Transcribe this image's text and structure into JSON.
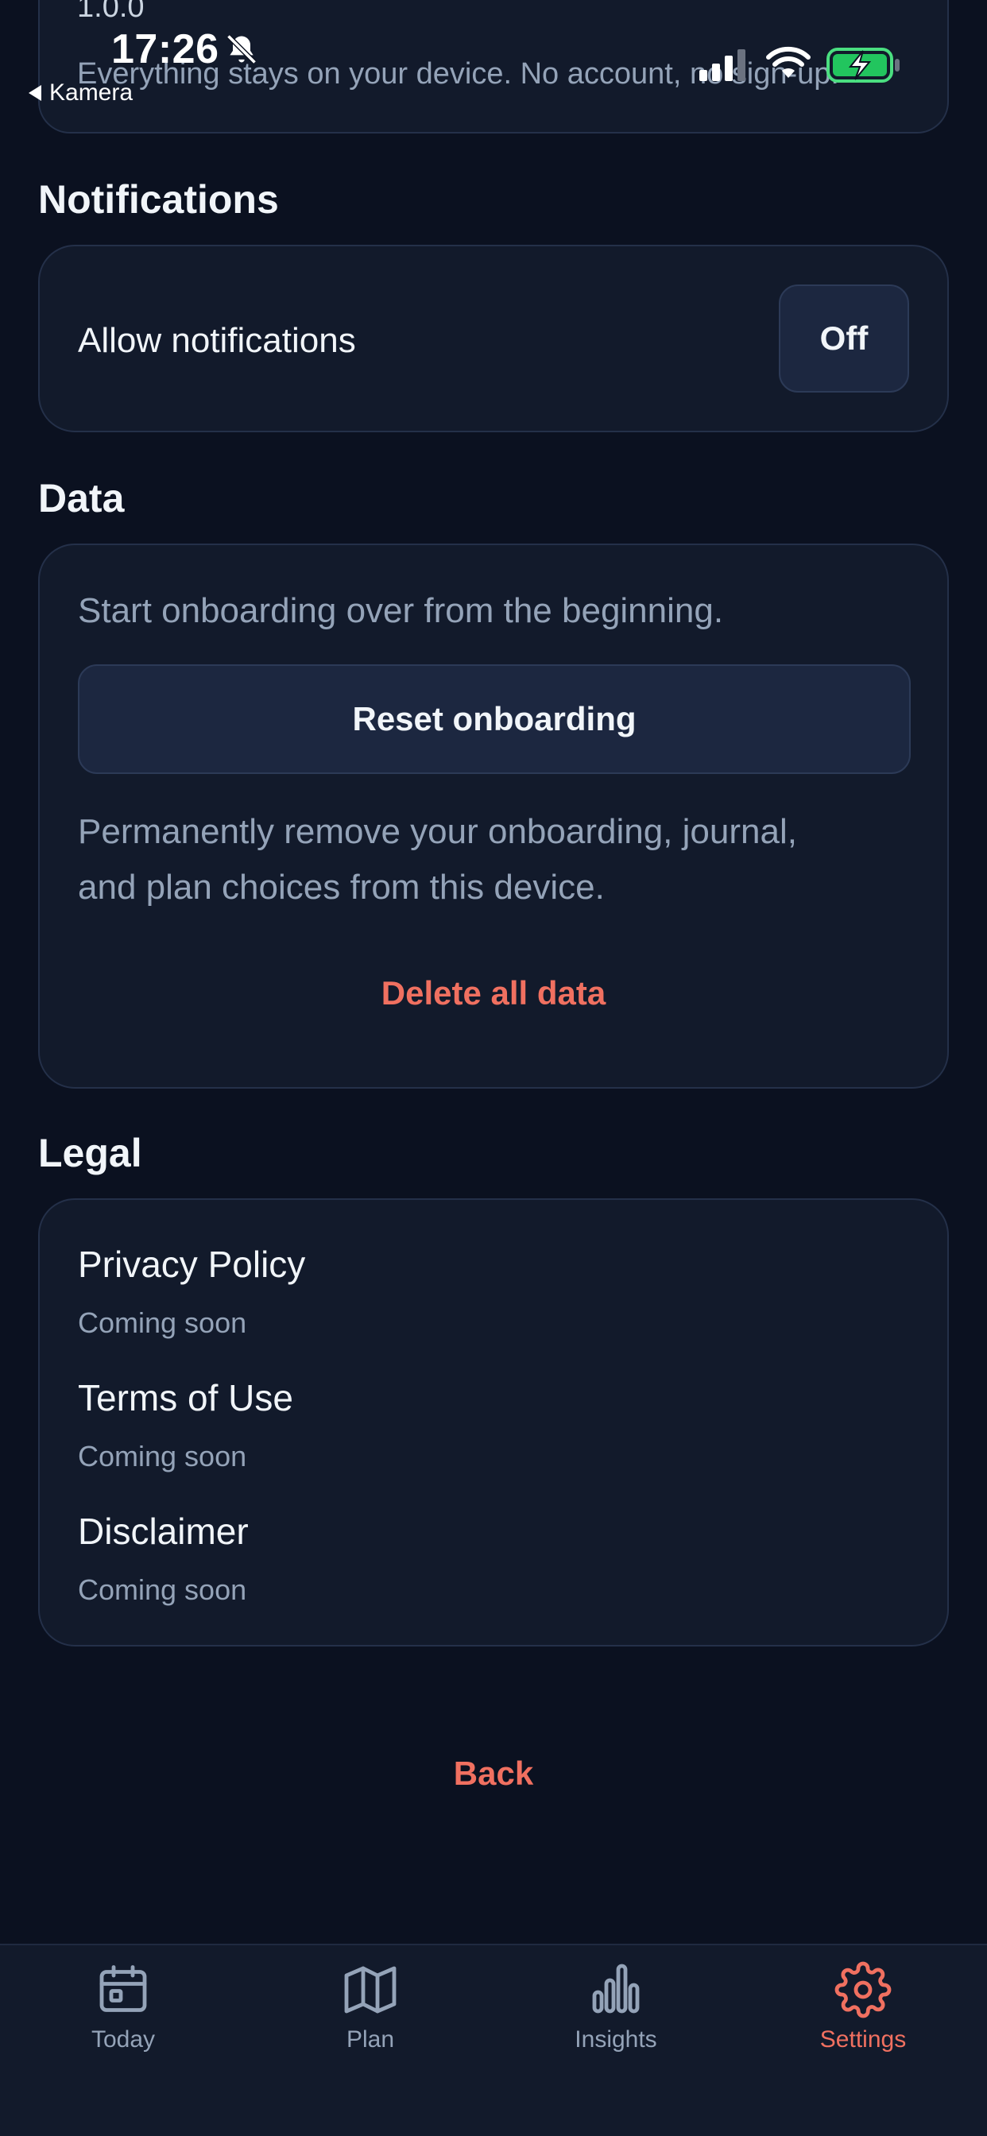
{
  "status_bar": {
    "time": "17:26",
    "back_label": "Kamera"
  },
  "about": {
    "version": "1.0.0",
    "privacy_note": "Everything stays on your device. No account, no sign-up."
  },
  "notifications": {
    "title": "Notifications",
    "allow_label": "Allow notifications",
    "toggle_value": "Off"
  },
  "data_section": {
    "title": "Data",
    "reset_description": "Start onboarding over from the beginning.",
    "reset_button": "Reset onboarding",
    "delete_description_line1": "Permanently remove your onboarding, journal,",
    "delete_description_line2": "and plan choices from this device.",
    "delete_button": "Delete all data"
  },
  "legal": {
    "title": "Legal",
    "items": [
      {
        "title": "Privacy Policy",
        "subtitle": "Coming soon"
      },
      {
        "title": "Terms of Use",
        "subtitle": "Coming soon"
      },
      {
        "title": "Disclaimer",
        "subtitle": "Coming soon"
      }
    ]
  },
  "back_button": "Back",
  "tabbar": {
    "active": "Settings",
    "accent_color": "#f07060",
    "tabs": [
      {
        "label": "Today",
        "icon": "calendar-icon"
      },
      {
        "label": "Plan",
        "icon": "map-icon"
      },
      {
        "label": "Insights",
        "icon": "bar-chart-icon"
      },
      {
        "label": "Settings",
        "icon": "gear-icon"
      }
    ]
  }
}
